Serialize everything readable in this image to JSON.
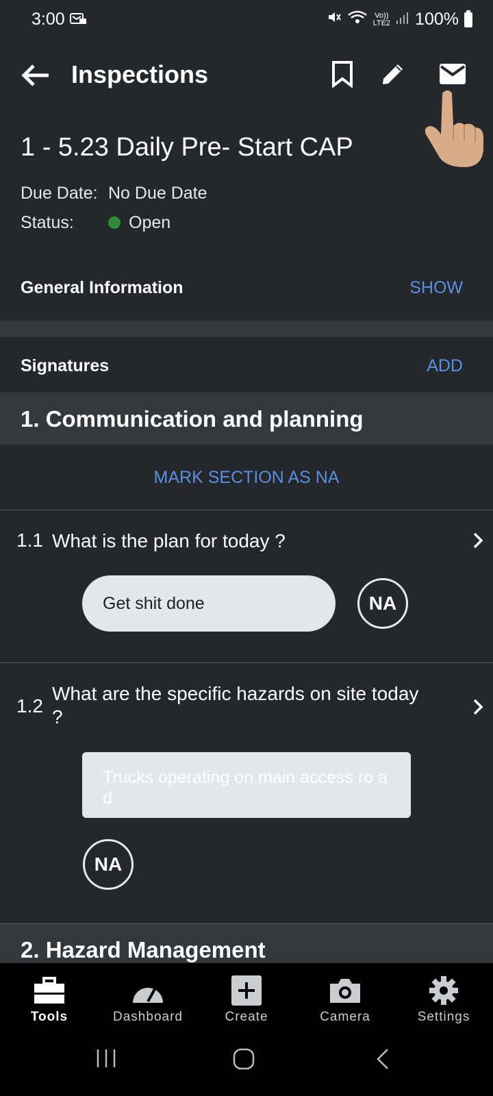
{
  "status_bar": {
    "time": "3:00",
    "battery": "100%",
    "network": "LTE2"
  },
  "app_bar": {
    "title": "Inspections",
    "back_icon": "arrow-left-icon",
    "bookmark_icon": "bookmark-icon",
    "edit_icon": "pencil-icon",
    "email_icon": "mail-icon"
  },
  "inspection": {
    "title": "1 - 5.23 Daily Pre- Start CAP",
    "due_date_label": "Due Date:",
    "due_date_value": "No Due Date",
    "status_label": "Status:",
    "status_value": "Open",
    "status_color": "#2e8b3a"
  },
  "general_info": {
    "label": "General Information",
    "action": "SHOW"
  },
  "signatures": {
    "label": "Signatures",
    "action": "ADD"
  },
  "sections": [
    {
      "title": "1. Communication and planning",
      "mark_na": "MARK SECTION AS NA",
      "questions": [
        {
          "number": "1.1",
          "text": "What is the plan for today ?",
          "answer": "Get shit done",
          "na": "NA"
        },
        {
          "number": "1.2",
          "text": "What are the specific hazards on site today ?",
          "answer": "Trucks operating on main access ro ad",
          "na": "NA"
        }
      ]
    },
    {
      "title": "2. Hazard Management"
    }
  ],
  "bottom_nav": [
    {
      "label": "Tools",
      "icon": "toolbox-icon",
      "active": true
    },
    {
      "label": "Dashboard",
      "icon": "gauge-icon",
      "active": false
    },
    {
      "label": "Create",
      "icon": "plus-square-icon",
      "active": false
    },
    {
      "label": "Camera",
      "icon": "camera-icon",
      "active": false
    },
    {
      "label": "Settings",
      "icon": "gear-icon",
      "active": false
    }
  ],
  "colors": {
    "accent": "#5b8fe0",
    "background": "#24272b",
    "section_bg": "#33383d"
  }
}
